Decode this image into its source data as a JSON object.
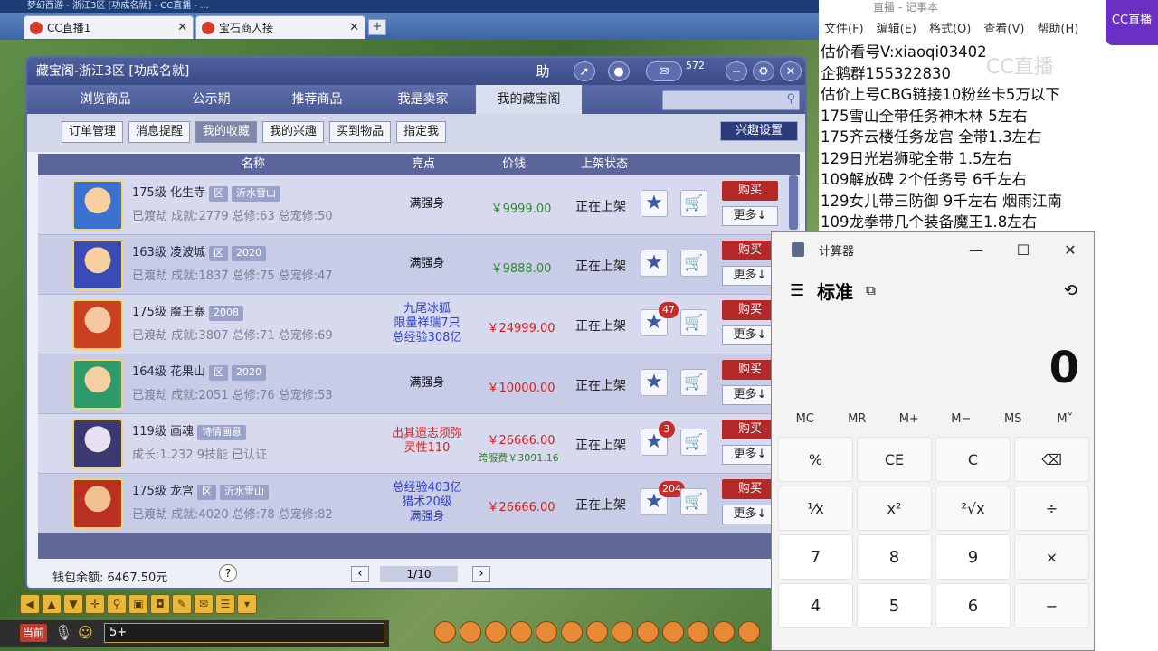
{
  "browser": {
    "window_title": "梦幻西游 - 浙江3区 [功成名就] - CC直播 - ...",
    "tabs": [
      {
        "label": "CC直播1"
      },
      {
        "label": "宝石商人接"
      }
    ],
    "new_tab": "+"
  },
  "cbg": {
    "title": "藏宝阁-浙江3区 [功成名就]",
    "help_btn": "助",
    "msg_count": "572",
    "nav_tabs": [
      "浏览商品",
      "公示期",
      "推荐商品",
      "我是卖家",
      "我的藏宝阁"
    ],
    "sub_tabs": [
      "订单管理",
      "消息提醒",
      "我的收藏",
      "我的兴趣",
      "买到物品",
      "指定我"
    ],
    "interest_btn": "兴趣设置",
    "columns": [
      "名称",
      "亮点",
      "价钱",
      "上架状态"
    ],
    "rows": [
      {
        "name": "175级 化生寺",
        "tags": [
          "区",
          "沂水雪山"
        ],
        "sub": "已渡劫 成就:2779 总修:63 总宠修:50",
        "highlight": [
          "满强身"
        ],
        "hl_color": "#111",
        "price": "￥9999.00",
        "price_color": "#2f8a2f",
        "fee": "",
        "status": "正在上架",
        "count": ""
      },
      {
        "name": "163级 凌波城",
        "tags": [
          "区",
          "2020"
        ],
        "sub": "已渡劫 成就:1837 总修:75 总宠修:47",
        "highlight": [
          "满强身"
        ],
        "hl_color": "#111",
        "price": "￥9888.00",
        "price_color": "#2f8a2f",
        "fee": "",
        "status": "正在上架",
        "count": ""
      },
      {
        "name": "175级 魔王寨",
        "tags": [
          "2008"
        ],
        "sub": "已渡劫 成就:3807 总修:71 总宠修:69",
        "highlight": [
          "九尾冰狐",
          "限量祥瑞7只",
          "总经验308亿"
        ],
        "hl_color": "#2d3fd0",
        "price": "￥24999.00",
        "price_color": "#d42020",
        "fee": "",
        "status": "正在上架",
        "count": "47"
      },
      {
        "name": "164级 花果山",
        "tags": [
          "区",
          "2020"
        ],
        "sub": "已渡劫 成就:2051 总修:76 总宠修:53",
        "highlight": [
          "满强身"
        ],
        "hl_color": "#111",
        "price": "￥10000.00",
        "price_color": "#d42020",
        "fee": "",
        "status": "正在上架",
        "count": ""
      },
      {
        "name": "119级 画魂",
        "tags": [
          "诗情画意"
        ],
        "sub": "成长:1.232 9技能 已认证",
        "highlight": [
          "出其遗志须弥",
          "灵性110"
        ],
        "hl_color": "#d42020",
        "price": "￥26666.00",
        "price_color": "#d42020",
        "fee": "跨服费￥3091.16",
        "status": "正在上架",
        "count": "3"
      },
      {
        "name": "175级 龙宫",
        "tags": [
          "区",
          "沂水雪山"
        ],
        "sub": "已渡劫 成就:4020 总修:78 总宠修:82",
        "highlight": [
          "总经验403亿",
          "猎术20级",
          "满强身"
        ],
        "hl_color": "#2d3fd0",
        "price": "￥26666.00",
        "price_color": "#d42020",
        "fee": "",
        "status": "正在上架",
        "count": "204"
      }
    ],
    "buy_label": "购买",
    "more_label": "更多↓",
    "wallet": "钱包余额: 6467.50元",
    "page": "1/10"
  },
  "chat": {
    "current": "当前",
    "input": "5+"
  },
  "notepad": {
    "title": "直播 - 记事本",
    "menu": [
      "文件(F)",
      "编辑(E)",
      "格式(O)",
      "查看(V)",
      "帮助(H)"
    ],
    "lines": [
      "估价看号V:xiaoqi03402",
      "企鹅群155322830",
      "估价上号CBG链接10粉丝卡5万以下",
      "175雪山全带任务神木林 5左右",
      "175齐云楼任务龙宫  全带1.3左右",
      "129日光岩狮驼全带  1.5左右",
      "109解放碑 2个任务号 6千左右",
      "129女儿带三防御 9千左右 烟雨江南",
      "109龙拳带几个装备魔王1.8左右"
    ]
  },
  "cc": {
    "logo": "CC直播",
    "watermark": "CC直播"
  },
  "calculator": {
    "title": "计算器",
    "mode": "标准",
    "display": "0",
    "memory": [
      "MC",
      "MR",
      "M+",
      "M−",
      "MS",
      "M˅"
    ],
    "keys": [
      "%",
      "CE",
      "C",
      "⌫",
      "¹⁄x",
      "x²",
      "²√x",
      "÷",
      "7",
      "8",
      "9",
      "×",
      "4",
      "5",
      "6",
      "−"
    ]
  }
}
